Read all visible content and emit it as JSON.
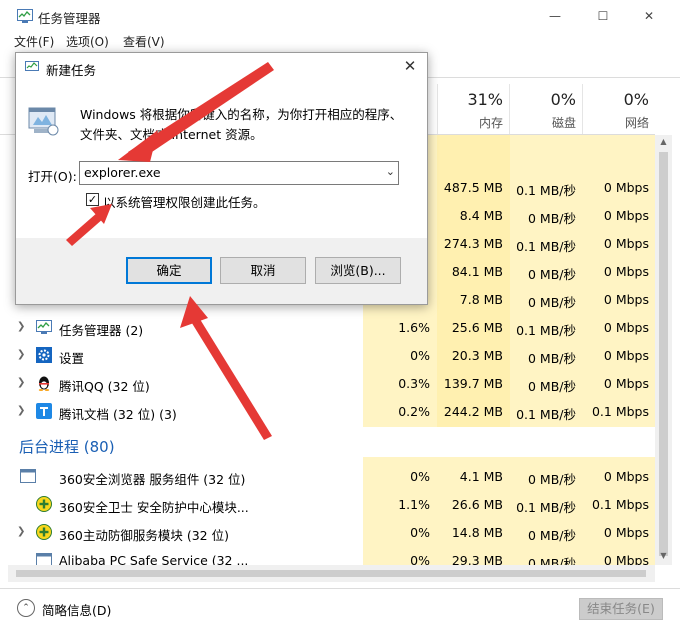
{
  "window": {
    "title": "任务管理器",
    "controls": {
      "minimize": "—",
      "maximize": "☐",
      "close": "✕"
    }
  },
  "menu": {
    "file": "文件(F)",
    "options": "选项(O)",
    "view": "查看(V)"
  },
  "columns": {
    "memory": {
      "percent": "31%",
      "label": "内存"
    },
    "disk": {
      "percent": "0%",
      "label": "磁盘"
    },
    "network": {
      "percent": "0%",
      "label": "网络"
    }
  },
  "apps_rows_hidden": [
    {
      "mem": "487.5 MB",
      "disk": "0.1 MB/秒",
      "net": "0 Mbps"
    },
    {
      "mem": "8.4 MB",
      "disk": "0 MB/秒",
      "net": "0 Mbps"
    },
    {
      "mem": "274.3 MB",
      "disk": "0.1 MB/秒",
      "net": "0 Mbps"
    },
    {
      "mem": "84.1 MB",
      "disk": "0 MB/秒",
      "net": "0 Mbps"
    },
    {
      "mem": "7.8 MB",
      "disk": "0 MB/秒",
      "net": "0 Mbps"
    }
  ],
  "apps": [
    {
      "name": "任务管理器 (2)",
      "cpu": "1.6%",
      "mem": "25.6 MB",
      "disk": "0.1 MB/秒",
      "net": "0 Mbps",
      "icon": "task-manager-icon"
    },
    {
      "name": "设置",
      "cpu": "0%",
      "mem": "20.3 MB",
      "disk": "0 MB/秒",
      "net": "0 Mbps",
      "icon": "settings-gear-icon"
    },
    {
      "name": "腾讯QQ (32 位)",
      "cpu": "0.3%",
      "mem": "139.7 MB",
      "disk": "0 MB/秒",
      "net": "0 Mbps",
      "icon": "qq-penguin-icon"
    },
    {
      "name": "腾讯文档 (32 位) (3)",
      "cpu": "0.2%",
      "mem": "244.2 MB",
      "disk": "0.1 MB/秒",
      "net": "0.1 Mbps",
      "icon": "tencent-docs-icon"
    }
  ],
  "background_group": {
    "title": "后台进程 (80)"
  },
  "background": [
    {
      "name": "360安全浏览器 服务组件 (32 位)",
      "cpu": "0%",
      "mem": "4.1 MB",
      "disk": "0 MB/秒",
      "net": "0 Mbps",
      "icon": "service-window-icon"
    },
    {
      "name": "360安全卫士 安全防护中心模块...",
      "cpu": "1.1%",
      "mem": "26.6 MB",
      "disk": "0.1 MB/秒",
      "net": "0.1 Mbps",
      "icon": "shield-plus-icon"
    },
    {
      "name": "360主动防御服务模块 (32 位)",
      "cpu": "0%",
      "mem": "14.8 MB",
      "disk": "0 MB/秒",
      "net": "0 Mbps",
      "icon": "shield-plus-icon"
    },
    {
      "name": "Alibaba PC Safe Service (32 ...",
      "cpu": "0%",
      "mem": "29.3 MB",
      "disk": "0 MB/秒",
      "net": "0 Mbps",
      "icon": "service-window-icon"
    }
  ],
  "footer": {
    "fewer_details": "简略信息(D)",
    "end_task": "结束任务(E)"
  },
  "dialog": {
    "title": "新建任务",
    "description": "Windows 将根据你所键入的名称，为你打开相应的程序、文件夹、文档或 Internet 资源。",
    "open_label": "打开(O):",
    "open_value": "explorer.exe",
    "admin_checkbox_label": "以系统管理权限创建此任务。",
    "admin_checked": true,
    "ok": "确定",
    "cancel": "取消",
    "browse": "浏览(B)..."
  },
  "colors": {
    "accent": "#0078d7",
    "heat": "#fff4c4",
    "group_title": "#1a5fb4",
    "annotation": "#e53935"
  }
}
